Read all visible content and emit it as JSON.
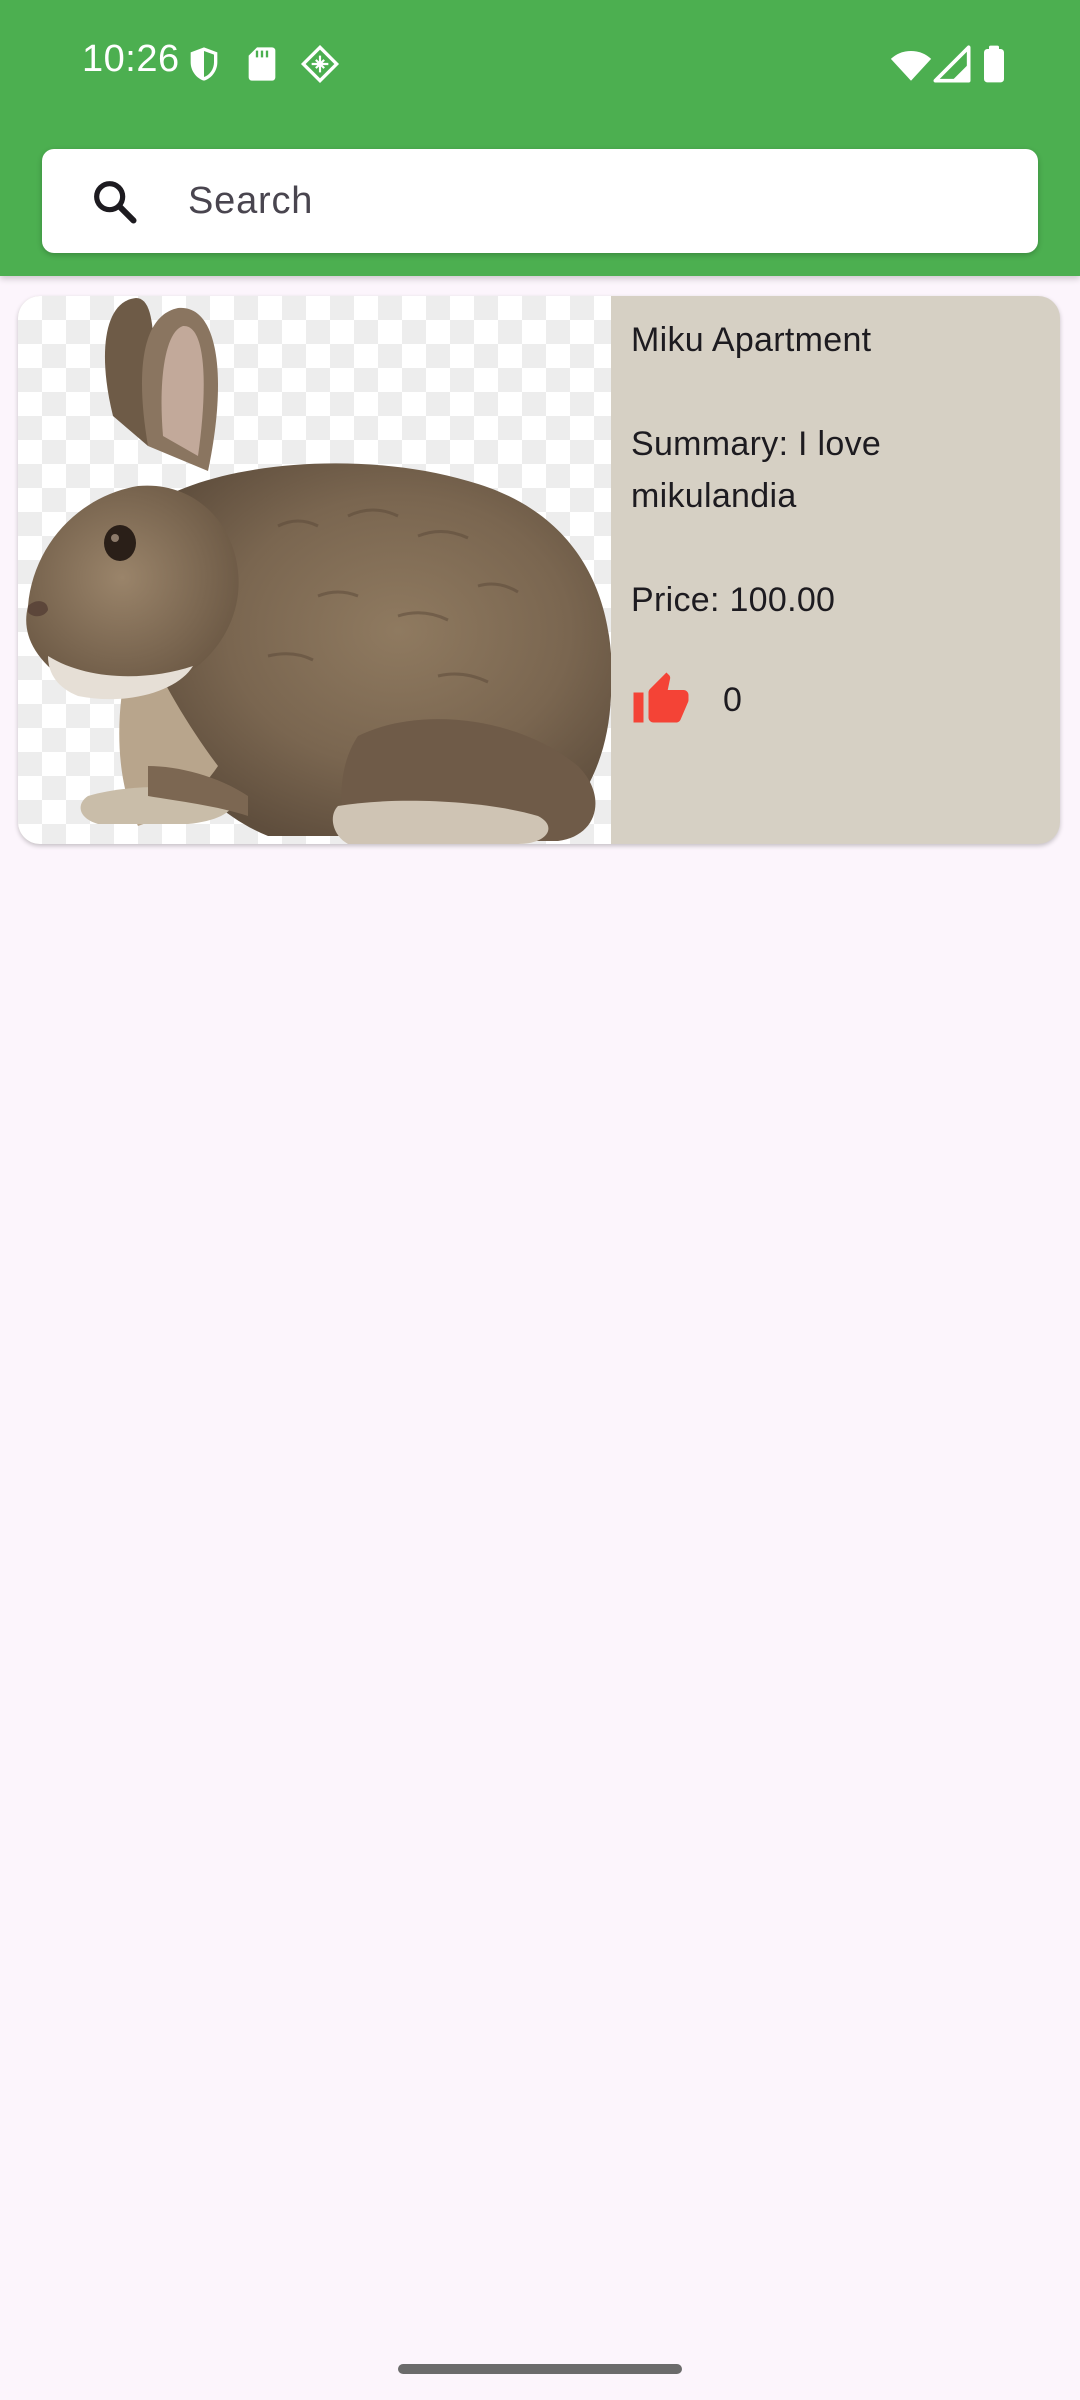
{
  "status_bar": {
    "time": "10:26",
    "icons": [
      "shield-icon",
      "sd-card-icon",
      "diamond-grid-icon",
      "wifi-icon",
      "cellular-signal-icon",
      "battery-icon"
    ]
  },
  "app_bar": {
    "color": "#4caf50"
  },
  "search": {
    "placeholder": "Search",
    "value": "",
    "icon": "search-icon"
  },
  "listings": [
    {
      "image": "rabbit-photo",
      "title": "Miku Apartment",
      "summary": "Summary: I love mikulandia",
      "price": "Price: 100.00",
      "like_icon": "thumb-up-icon",
      "like_color": "#f44336",
      "likes": "0"
    }
  ],
  "colors": {
    "background": "#fcf5fc",
    "card_info_background": "#d6d0c4"
  }
}
